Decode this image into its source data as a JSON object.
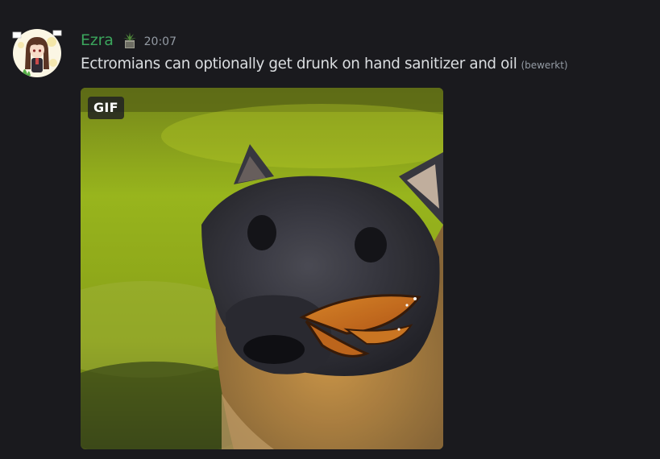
{
  "message": {
    "author": {
      "name": "Ezra",
      "name_color": "#3ba55c",
      "avatar_icon": "anime-girl-avatar-icon",
      "role_icon": "plant-role-icon"
    },
    "timestamp": "20:07",
    "text": "Ectromians can optionally get drunk on hand sanitizer and oil",
    "edited_label": "(bewerkt)",
    "attachment": {
      "type": "gif",
      "badge": "GIF",
      "image_icon": "dog-with-butterfly-image"
    }
  },
  "colors": {
    "background": "#1a1a1e",
    "text": "#dbdee1",
    "muted": "#949ba4"
  }
}
